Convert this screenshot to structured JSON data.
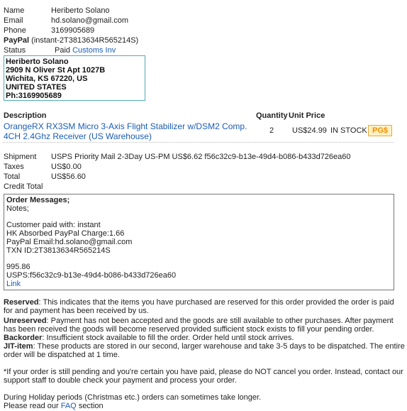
{
  "customer": {
    "name_label": "Name",
    "name": "Heriberto Solano",
    "email_label": "Email",
    "email": "hd.solano@gmail.com",
    "phone_label": "Phone",
    "phone": "3169905689",
    "paypal_label": "PayPal",
    "paypal_value": "(instant-2T3813634R565214S)",
    "status_label": "Status",
    "status_value": "Paid",
    "customs_link": "Customs Inv"
  },
  "address": {
    "line1": "Heriberto Solano",
    "line2": "2909 N Oliver St Apt 1027B",
    "line3": "Wichita, KS 67220, US",
    "line4": "UNITED STATES",
    "line5": "Ph:3169905689"
  },
  "order_table": {
    "col_description": "Description",
    "col_quantity": "Quantity",
    "col_unit_price": "Unit Price",
    "item_name_line1": "OrangeRX RX3SM Micro 3-Axis Flight Stabilizer w/DSM2 Comp.",
    "item_name_line2": "4CH 2.4Ghz Receiver (US Warehouse)",
    "item_quantity": "2",
    "item_price": "US$24.99",
    "item_stock": "IN STOCK",
    "item_badge": "PG$"
  },
  "totals": {
    "shipment_label": "Shipment",
    "shipment_value": "USPS Priority Mail 2-3Day US-PM US$6.62 f56c32c9-b13e-49d4-b086-b433d726ea60",
    "taxes_label": "Taxes",
    "taxes_value": "US$0.00",
    "total_label": "Total",
    "total_value": "US$56.60",
    "credit_label": "Credit Total"
  },
  "messages": {
    "title": "Order Messages;",
    "notes": "Notes;",
    "paid_with": "Customer paid with: instant",
    "hk_charge": "HK Absorbed PayPal Charge:1.66",
    "paypal_email": "PayPal Email:hd.solano@gmail.com",
    "txn_id": "TXN ID:2T3813634R565214S",
    "amount": "995.86",
    "usps": "USPS:f56c32c9-b13e-49d4-b086-b433d726ea60",
    "link": "Link"
  },
  "info": {
    "reserved_term": "Reserved",
    "reserved_text": ": This indicates that the items you have purchased are reserved for this order provided the order is paid for and payment has been received by us.",
    "unreserved_term": "Unreserved",
    "unreserved_text": ": Payment has not been accepted and the goods are still available to other purchases. After payment has been received the goods will become reserved provided sufficient stock exists to fill your pending order.",
    "backorder_term": "Backorder",
    "backorder_text": ": Insufficient stock available to fill the order. Order held until stock arrives.",
    "jit_term": "JIT-item",
    "jit_text": ": These products are stored in our second, larger warehouse and take 3-5 days to be dispatched. The entire order will be dispatched at 1 time.",
    "pending_note": "*If your order is still pending and you're certain you have paid, please do NOT cancel you order. Instead, contact our support staff to double check your payment and process your order.",
    "holiday_note": "During Holiday periods (Christmas etc.) orders can sometimes take longer.",
    "faq_prefix": "Please read our",
    "faq_link": "FAQ",
    "faq_suffix": "section"
  }
}
